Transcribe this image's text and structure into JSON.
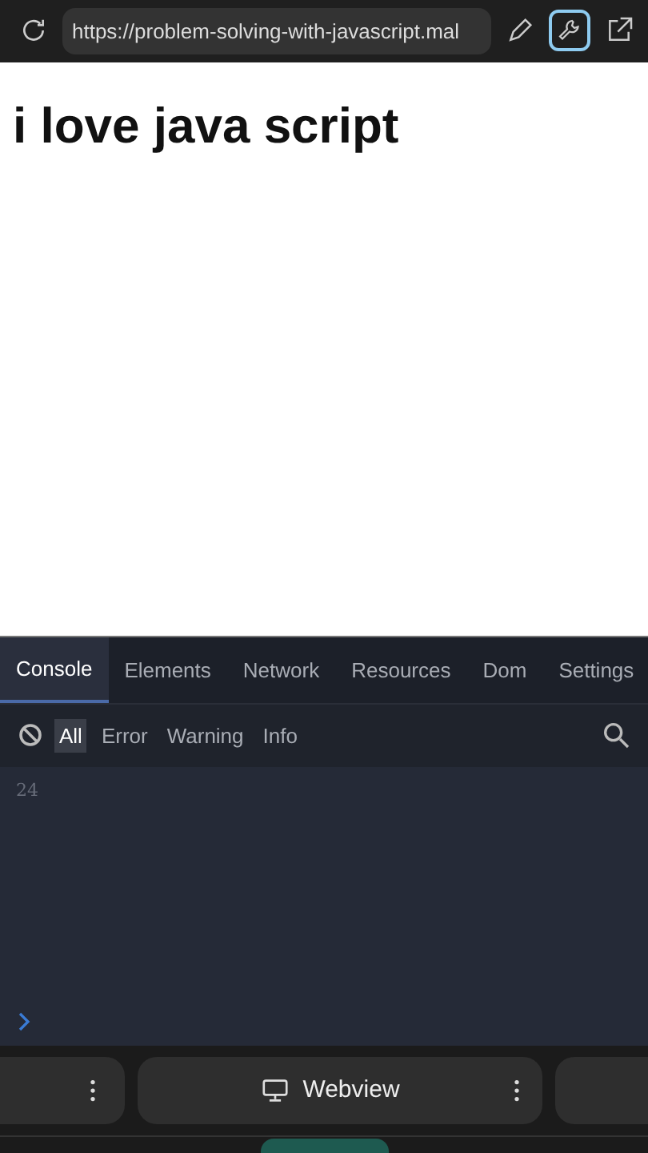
{
  "browser_bar": {
    "url": "https://problem-solving-with-javascript.mal"
  },
  "page": {
    "heading": "i love java script"
  },
  "devtools": {
    "tabs": [
      {
        "label": "Console",
        "selected": true
      },
      {
        "label": "Elements",
        "selected": false
      },
      {
        "label": "Network",
        "selected": false
      },
      {
        "label": "Resources",
        "selected": false
      },
      {
        "label": "Dom",
        "selected": false
      },
      {
        "label": "Settings",
        "selected": false
      }
    ],
    "filters": [
      {
        "label": "All",
        "selected": true
      },
      {
        "label": "Error",
        "selected": false
      },
      {
        "label": "Warning",
        "selected": false
      },
      {
        "label": "Info",
        "selected": false
      }
    ],
    "console_lines": [
      "24"
    ]
  },
  "bottom_tabs": [
    {
      "label": "Webview"
    }
  ]
}
